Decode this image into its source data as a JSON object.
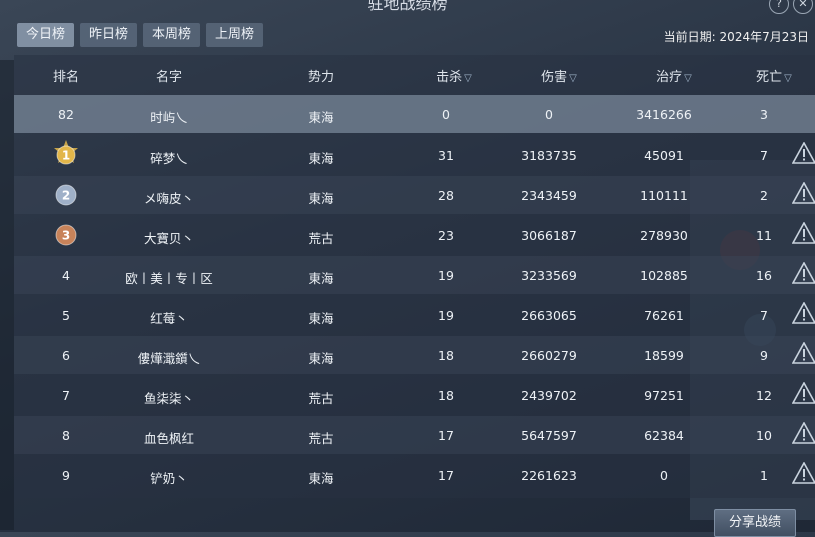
{
  "title": "驻地战绩榜",
  "tabs": [
    {
      "label": "今日榜",
      "active": true
    },
    {
      "label": "昨日榜",
      "active": false
    },
    {
      "label": "本周榜",
      "active": false
    },
    {
      "label": "上周榜",
      "active": false
    }
  ],
  "date": {
    "label": "当前日期:",
    "value": "2024年7月23日"
  },
  "columns": [
    "排名",
    "名字",
    "势力",
    "击杀",
    "伤害",
    "治疗",
    "死亡"
  ],
  "self_row": {
    "rank": "82",
    "name": "时屿乀",
    "faction": "東海",
    "kills": "0",
    "damage": "0",
    "healing": "3416266",
    "deaths": "3"
  },
  "rows": [
    {
      "rank": "1",
      "name": "碎梦乀",
      "faction": "東海",
      "kills": "31",
      "damage": "3183735",
      "healing": "45091",
      "deaths": "7"
    },
    {
      "rank": "2",
      "name": "メ嗨皮丶",
      "faction": "東海",
      "kills": "28",
      "damage": "2343459",
      "healing": "110111",
      "deaths": "2"
    },
    {
      "rank": "3",
      "name": "大寶贝丶",
      "faction": "荒古",
      "kills": "23",
      "damage": "3066187",
      "healing": "278930",
      "deaths": "11"
    },
    {
      "rank": "4",
      "name": "欧丨美丨专丨区",
      "faction": "東海",
      "kills": "19",
      "damage": "3233569",
      "healing": "102885",
      "deaths": "16"
    },
    {
      "rank": "5",
      "name": "红莓丶",
      "faction": "東海",
      "kills": "19",
      "damage": "2663065",
      "healing": "76261",
      "deaths": "7"
    },
    {
      "rank": "6",
      "name": "僂燁濈鑕乀",
      "faction": "東海",
      "kills": "18",
      "damage": "2660279",
      "healing": "18599",
      "deaths": "9"
    },
    {
      "rank": "7",
      "name": "鱼柒柒丶",
      "faction": "荒古",
      "kills": "18",
      "damage": "2439702",
      "healing": "97251",
      "deaths": "12"
    },
    {
      "rank": "8",
      "name": "血色枫红",
      "faction": "荒古",
      "kills": "17",
      "damage": "5647597",
      "healing": "62384",
      "deaths": "10"
    },
    {
      "rank": "9",
      "name": "铲奶丶",
      "faction": "東海",
      "kills": "17",
      "damage": "2261623",
      "healing": "0",
      "deaths": "1"
    }
  ],
  "share_label": "分享战绩",
  "icons": {
    "sort": "sort-chevron-icon",
    "report": "warning-triangle-icon",
    "medal": "rank-medal-icon"
  },
  "colors": {
    "gold": "#e2b64a",
    "silver": "#9fb0c8",
    "bronze": "#c8835a",
    "highlight_row": "#7a8798"
  }
}
